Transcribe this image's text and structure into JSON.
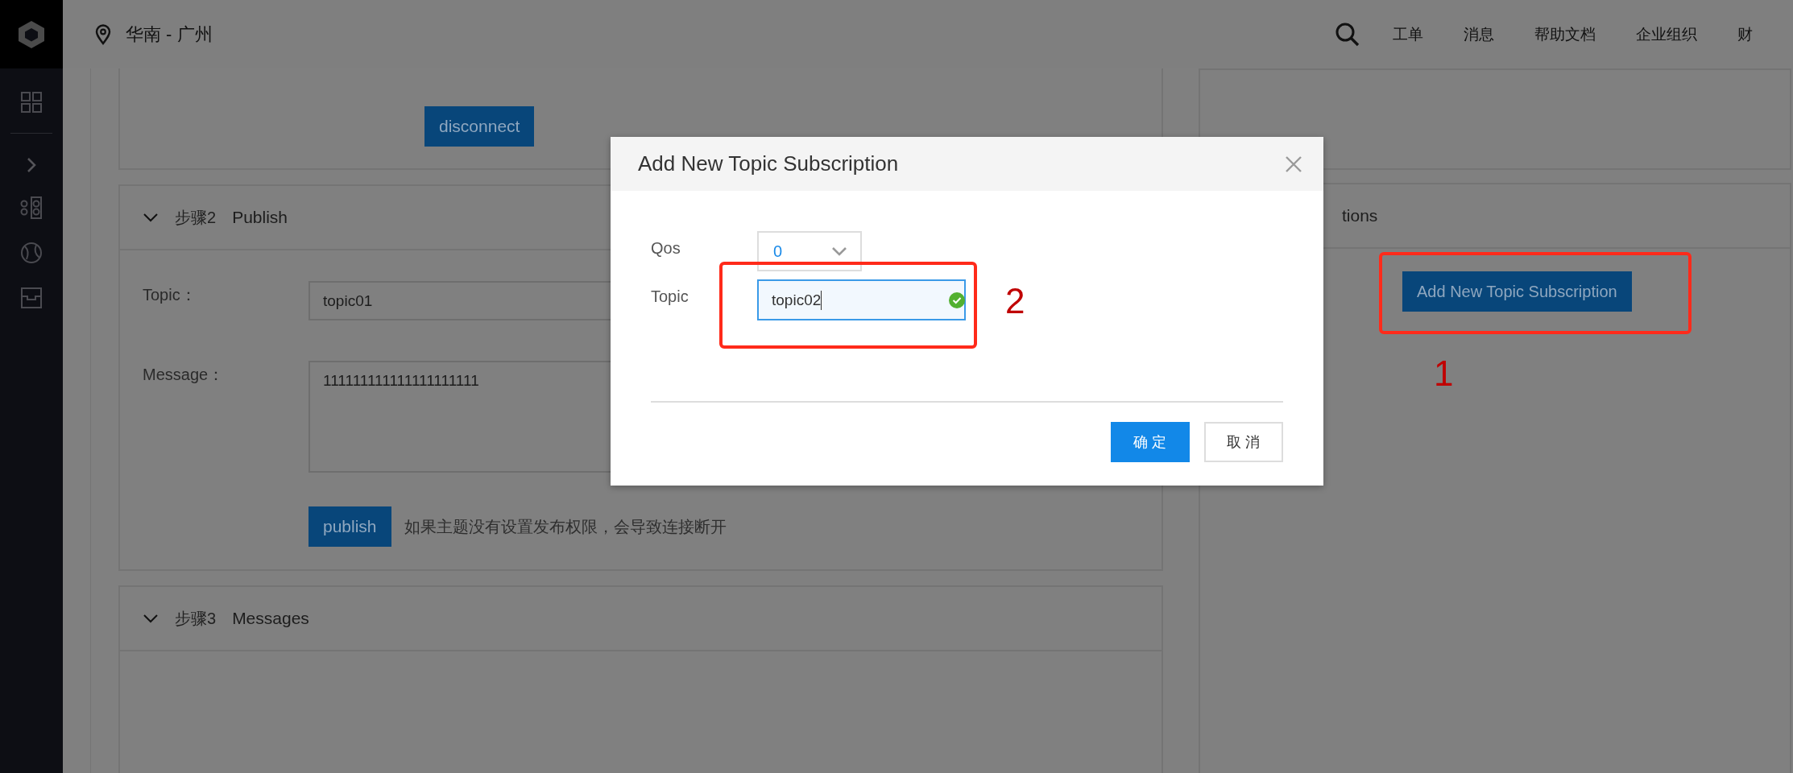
{
  "topbar": {
    "region": "华南 - 广州",
    "nav": [
      "工单",
      "消息",
      "帮助文档",
      "企业组织",
      "财"
    ]
  },
  "connect_panel": {
    "button": "disconnect"
  },
  "publish_panel": {
    "step": "步骤2",
    "title": "Publish",
    "expanded": true,
    "topic_label": "Topic：",
    "topic_value": "topic01",
    "message_label": "Message：",
    "message_value": "111111111111111111111",
    "button": "publish",
    "hint": "如果主题没有设置发布权限，会导致连接断开"
  },
  "messages_panel": {
    "step": "步骤3",
    "title": "Messages",
    "expanded": true
  },
  "subscriptions_panel": {
    "title": "tions",
    "button": "Add New Topic Subscription"
  },
  "dialog": {
    "title": "Add New Topic Subscription",
    "qos_label": "Qos",
    "qos_value": "0",
    "topic_label": "Topic",
    "topic_value": "topic02",
    "topic_valid": true,
    "buttons": [
      {
        "label": "确 定",
        "kind": "primary"
      },
      {
        "label": "取 消",
        "kind": "secondary"
      }
    ]
  },
  "annotations": [
    {
      "number": "1",
      "kind": "button"
    },
    {
      "number": "2",
      "kind": "field"
    }
  ]
}
